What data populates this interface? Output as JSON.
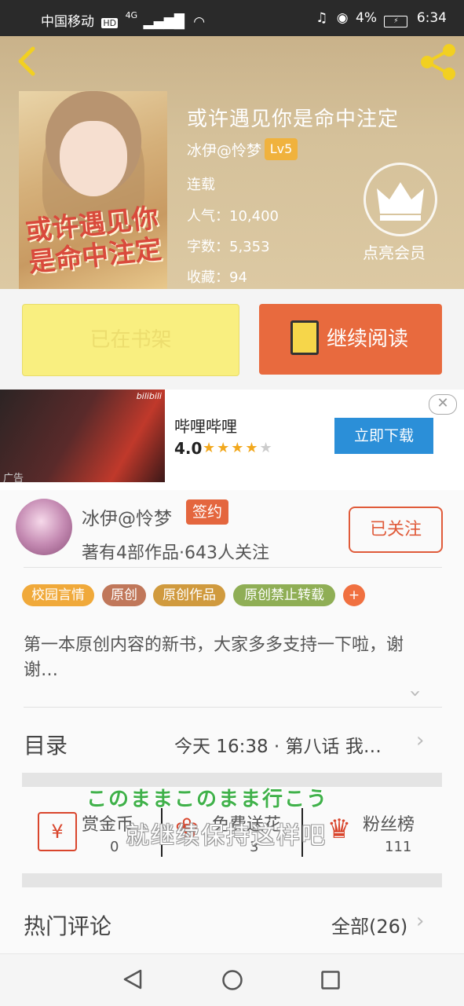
{
  "status_bar": {
    "carrier": "中国移动",
    "network": "4G",
    "battery": "4%",
    "time": "6:34"
  },
  "book": {
    "title": "或许遇见你是命中注定",
    "author": "冰伊@怜梦",
    "level": "Lv5",
    "status": "连载",
    "popularity_label": "人气：",
    "popularity": "10,400",
    "words_label": "字数：",
    "words": "5,353",
    "favorites_label": "收藏：",
    "favorites": "94",
    "vip_label": "点亮会员",
    "cover_title": "或许遇见你是命中注定"
  },
  "actions": {
    "shelf_label": "已在书架",
    "read_label": "继续阅读"
  },
  "ad": {
    "app_name": "哔哩哔哩",
    "rating": "4.0",
    "stars": "★★★★",
    "star_empty": "★",
    "download_label": "立即下载",
    "close_glyph": "✕",
    "ad_tag": "广告",
    "watermark": "bilibili"
  },
  "author_card": {
    "name": "冰伊@怜梦",
    "signed_label": "签约",
    "stats": "著有4部作品·643人关注",
    "follow_label": "已关注"
  },
  "tags": [
    {
      "label": "校园言情",
      "color": "#f0a93a"
    },
    {
      "label": "原创",
      "color": "#c0775a"
    },
    {
      "label": "原创作品",
      "color": "#d09a3e"
    },
    {
      "label": "原创禁止转载",
      "color": "#8fae55"
    },
    {
      "label": "+",
      "color": "#f07040"
    }
  ],
  "description": "第一本原创内容的新书，大家多多支持一下啦，谢谢…",
  "toc": {
    "label": "目录",
    "latest": "今天 16:38 · 第八话 我…"
  },
  "rewards": [
    {
      "label": "赏金币",
      "count": "0"
    },
    {
      "label": "免费送花",
      "count": "3"
    },
    {
      "label": "粉丝榜",
      "count": "111"
    }
  ],
  "lyrics": {
    "line1": "このままこのまま行こう",
    "line2": "就继续保持这样吧"
  },
  "comments": {
    "label": "热门评论",
    "all": "全部(26)"
  },
  "colors": {
    "accent": "#e86a3e",
    "shelf": "#f9ef80",
    "ad_button": "#2b8fd8"
  }
}
